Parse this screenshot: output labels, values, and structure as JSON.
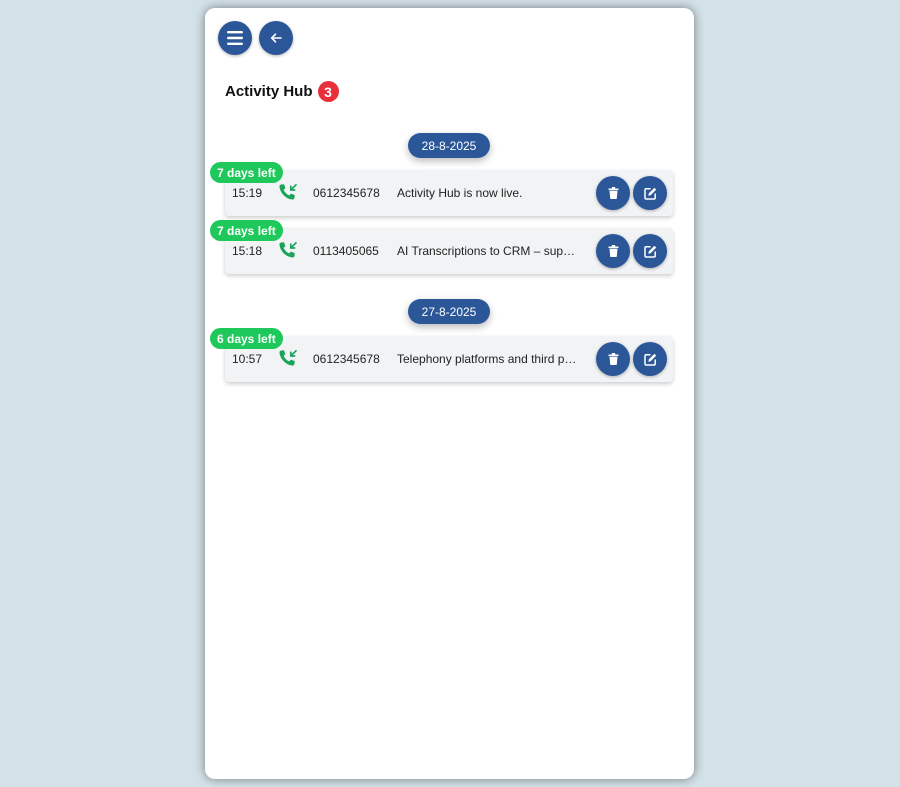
{
  "header": {
    "menu_icon": "hamburger-menu-icon",
    "back_icon": "arrow-left-icon",
    "title": "Activity Hub",
    "count": "3"
  },
  "colors": {
    "primary": "#2b5799",
    "badge_red": "#e8303a",
    "days_green": "#1ec85a",
    "call_icon_green": "#1aa35a",
    "row_bg": "#f1f3f5",
    "page_bg": "#d3e1e8"
  },
  "groups": [
    {
      "date": "28-8-2025",
      "items": [
        {
          "days_left": "7 days left",
          "time": "15:19",
          "call_icon": "incoming-call-icon",
          "phone": "0612345678",
          "note": "Activity Hub is now live.",
          "delete_icon": "trash-icon",
          "edit_icon": "edit-icon"
        },
        {
          "days_left": "7 days left",
          "time": "15:18",
          "call_icon": "incoming-call-icon",
          "phone": "0113405065",
          "note": "AI Transcriptions to CRM – sup…",
          "delete_icon": "trash-icon",
          "edit_icon": "edit-icon"
        }
      ]
    },
    {
      "date": "27-8-2025",
      "items": [
        {
          "days_left": "6 days left",
          "time": "10:57",
          "call_icon": "incoming-call-icon",
          "phone": "0612345678",
          "note": "Telephony platforms and third p…",
          "delete_icon": "trash-icon",
          "edit_icon": "edit-icon"
        }
      ]
    }
  ]
}
